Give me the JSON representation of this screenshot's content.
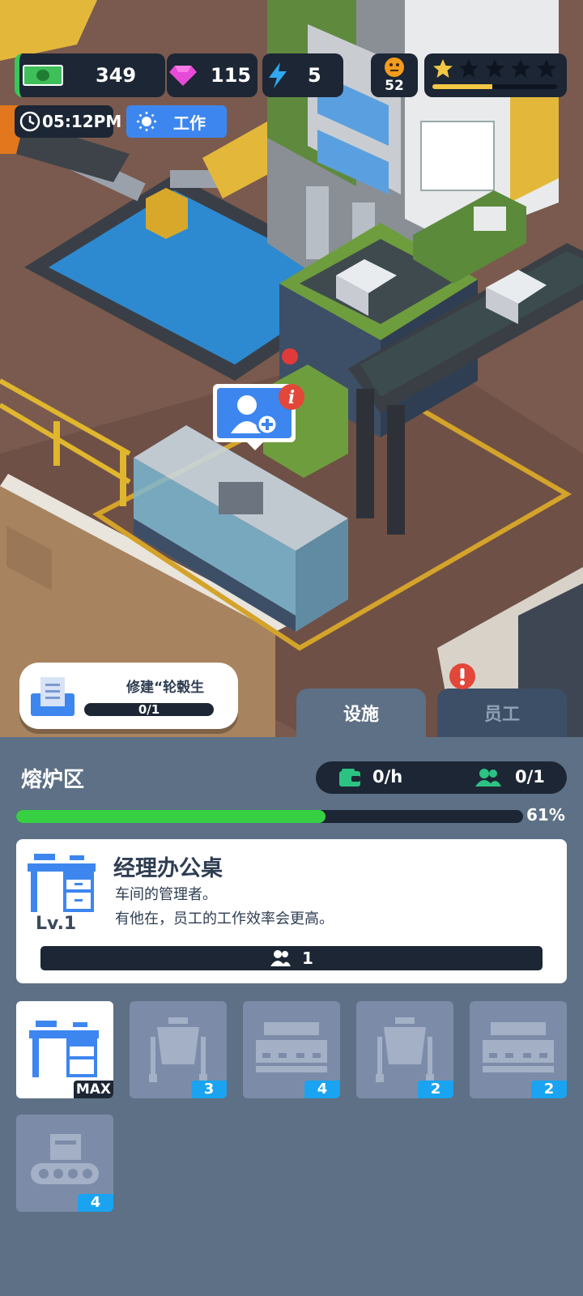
{
  "hud": {
    "money": "349",
    "gems": "115",
    "energy": "5",
    "mood": "52",
    "star_count": 1,
    "star_total": 5,
    "time": "05:12PM",
    "work_label": "工作"
  },
  "task": {
    "title": "修建“轮毂生",
    "progress": "0/1"
  },
  "tabs": {
    "facility": "设施",
    "staff": "员工"
  },
  "zone": {
    "name": "熔炉区",
    "income": "0/h",
    "workers": "0/1",
    "progress_percent": "61%",
    "progress_value": 0.61
  },
  "item": {
    "name": "经理办公桌",
    "desc1": "车间的管理者。",
    "desc2": "有他在，员工的工作效率会更高。",
    "level": "Lv.1",
    "staff": "1"
  },
  "slots": [
    {
      "icon": "desk-icon",
      "badge": "MAX"
    },
    {
      "icon": "furnace-icon",
      "badge": "3"
    },
    {
      "icon": "press-machine-icon",
      "badge": "4"
    },
    {
      "icon": "furnace-icon",
      "badge": "2"
    },
    {
      "icon": "press-machine-icon",
      "badge": "2"
    },
    {
      "icon": "conveyor-machine-icon",
      "badge": "4"
    }
  ],
  "colors": {
    "accent": "#3d86ef",
    "panel": "#5d7085",
    "dark": "#1c2634",
    "progress": "#38d043",
    "badge": "#1aa3f0"
  }
}
